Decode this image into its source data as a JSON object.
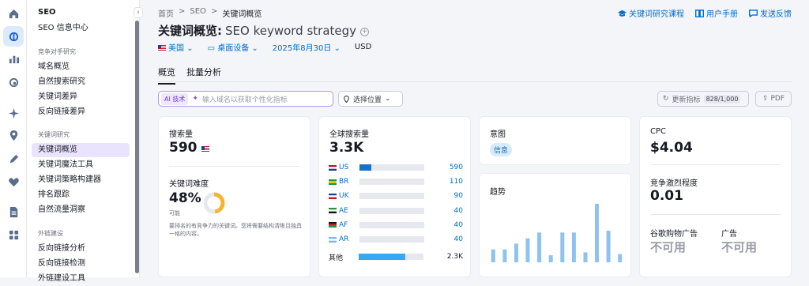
{
  "sidebar": {
    "section_title": "SEO",
    "top_item": "SEO 信息中心",
    "groups": [
      {
        "title": "竞争对手研究",
        "items": [
          "域名概览",
          "自然搜索研究",
          "关键词差异",
          "反向链接差异"
        ]
      },
      {
        "title": "关键词研究",
        "items": [
          "关键词概览",
          "关键词魔法工具",
          "关键词策略构建器",
          "排名跟踪",
          "自然流量洞察"
        ]
      },
      {
        "title": "外链建设",
        "items": [
          "反向链接分析",
          "反向链接检测",
          "外链建设工具"
        ]
      }
    ],
    "active_item": "关键词概览"
  },
  "rail_icons": [
    "home-icon",
    "seo-icon",
    "chart-icon",
    "local-icon",
    "ai-icon",
    "location-pin-icon",
    "content-icon",
    "social-icon",
    "report-icon",
    "apps-icon"
  ],
  "breadcrumb": {
    "home": "首页",
    "sep": ">",
    "seo": "SEO",
    "current": "关键词概览"
  },
  "top_links": {
    "course": "关键词研究课程",
    "manual": "用户手册",
    "feedback": "发送反馈"
  },
  "page": {
    "title": "关键词概览:",
    "keyword": "SEO keyword strategy"
  },
  "filters": {
    "country": "美国",
    "device": "桌面设备",
    "date": "2025年8月30日",
    "currency": "USD"
  },
  "tabs": [
    "概览",
    "批量分析"
  ],
  "toolbar": {
    "ai_badge": "AI 技术",
    "ai_placeholder": "输入域名以获取个性化指标",
    "location": "选择位置",
    "update": "更新指标",
    "update_count": "828/1,000",
    "pdf": "PDF"
  },
  "volume_card": {
    "label": "搜索量",
    "value": "590",
    "kd_label": "关键词难度",
    "kd_value": "48%",
    "kd_level": "可能",
    "kd_percent": 48,
    "kd_desc": "要排名的有竞争力的关键词。您将需要结构清晰且独具一格的内容。"
  },
  "global_card": {
    "label": "全球搜索量",
    "value": "3.3K",
    "countries": [
      {
        "code": "US",
        "value": "590",
        "share": 0.18
      },
      {
        "code": "BR",
        "value": "110",
        "share": 0
      },
      {
        "code": "UK",
        "value": "90",
        "share": 0
      },
      {
        "code": "AE",
        "value": "40",
        "share": 0
      },
      {
        "code": "AF",
        "value": "40",
        "share": 0
      },
      {
        "code": "AR",
        "value": "40",
        "share": 0
      }
    ],
    "other_label": "其他",
    "other_value": "2.3K",
    "other_share": 0.72
  },
  "intent_card": {
    "label": "意图",
    "intent": "信息"
  },
  "trend_card": {
    "label": "趋势",
    "values": [
      0.22,
      0.22,
      0.32,
      0.41,
      0.51,
      0.12,
      0.51,
      0.51,
      0.17,
      1.0,
      0.54,
      0.14
    ]
  },
  "cpc_card": {
    "label": "CPC",
    "value": "$4.04",
    "comp_label": "竞争激烈程度",
    "comp_value": "0.01",
    "shopping_label": "谷歌购物广告",
    "shopping_value": "不可用",
    "ads_label": "广告",
    "ads_value": "不可用"
  }
}
